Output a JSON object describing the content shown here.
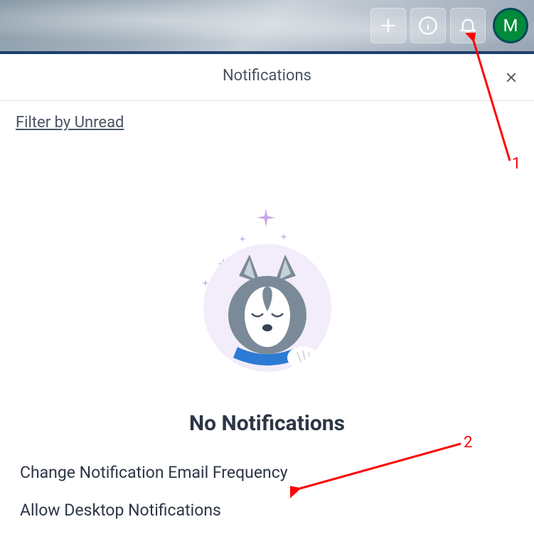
{
  "topbar": {
    "avatar_initial": "M"
  },
  "panel": {
    "title": "Notifications",
    "filter_label": "Filter by Unread",
    "empty_title": "No Notifications",
    "actions": {
      "change_frequency": "Change Notification Email Frequency",
      "allow_desktop": "Allow Desktop Notifications"
    }
  },
  "annotations": {
    "label1": "1",
    "label2": "2"
  }
}
